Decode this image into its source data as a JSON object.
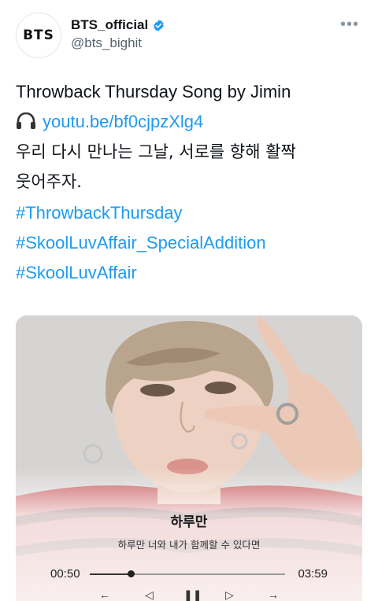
{
  "tweet": {
    "avatar_text": "BTS",
    "display_name": "BTS_official",
    "handle": "@bts_bighit",
    "more_icon": "more-options-icon",
    "verified_icon": "verified-badge-icon",
    "lines": {
      "title": "Throwback Thursday Song by Jimin",
      "link": "youtu.be/bf0cjpzXlg4",
      "korean_1": "우리 다시 만나는 그날, 서로를 향해 활짝",
      "korean_2": "웃어주자.",
      "hashtag_1": "#ThrowbackThursday",
      "hashtag_2": "#SkoolLuvAffair_SpecialAddition",
      "hashtag_3": "#SkoolLuvAffair"
    }
  },
  "player": {
    "song_title": "하루만",
    "lyric": "하루만 너와 내가 함께할 수 있다면",
    "current_time": "00:50",
    "total_time": "03:59",
    "progress": 0.21,
    "controls": [
      "back-icon",
      "previous-icon",
      "pause-icon",
      "next-icon",
      "forward-icon"
    ]
  },
  "colors": {
    "link": "#1d9bf0",
    "verified": "#1d9bf0"
  }
}
